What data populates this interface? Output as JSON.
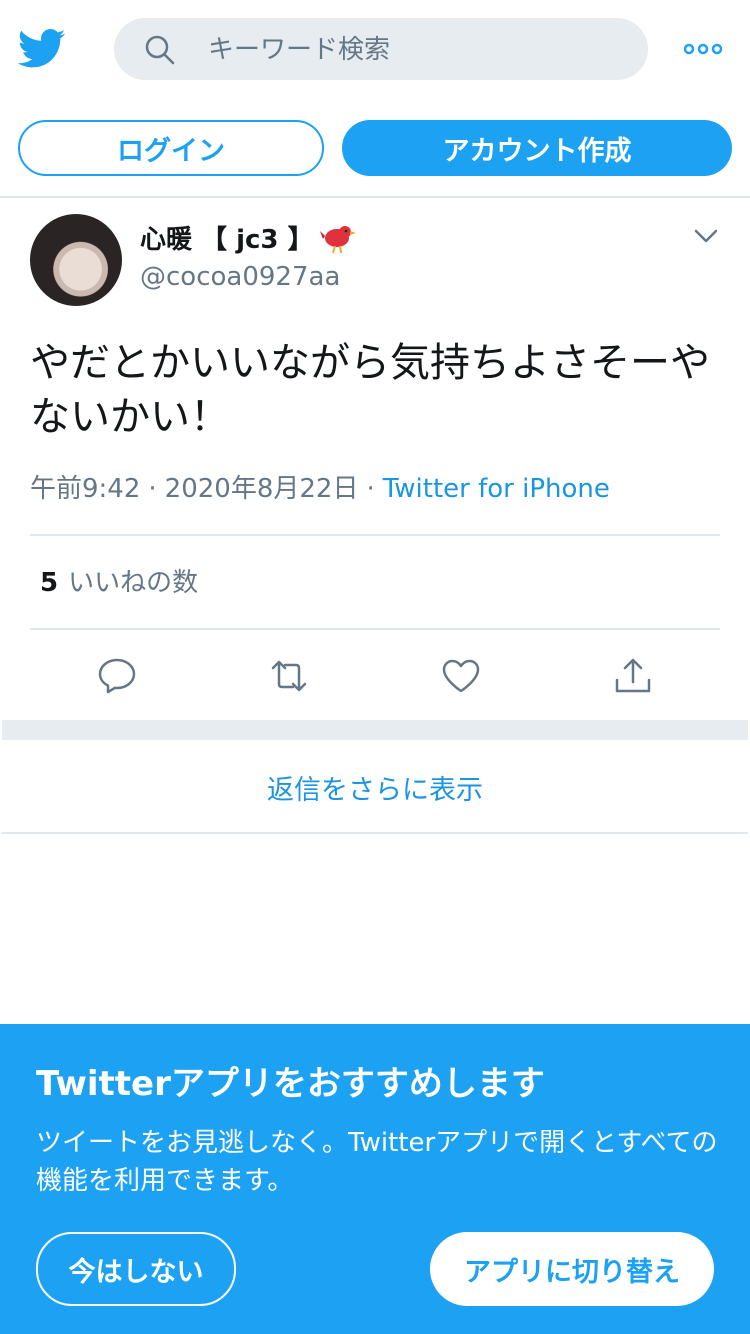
{
  "header": {
    "logo_icon": "twitter-bird-icon",
    "search": {
      "placeholder": "キーワード検索",
      "icon": "search-icon"
    },
    "more_icon": "more-dots-icon",
    "login_label": "ログイン",
    "signup_label": "アカウント作成"
  },
  "tweet": {
    "display_name": "心暖 【 jc3 】",
    "name_emoji": "bird-emoji",
    "handle": "@cocoa0927aa",
    "text": "やだとかいいながら気持ちよさそーやないかい！",
    "time": "午前9:42",
    "date": "2020年8月22日",
    "source": "Twitter for iPhone",
    "separator": "·",
    "likes_count": "5",
    "likes_label": "いいねの数",
    "actions": [
      "reply-icon",
      "retweet-icon",
      "like-icon",
      "share-icon"
    ]
  },
  "more_replies_label": "返信をさらに表示",
  "promo": {
    "title": "Twitterアプリをおすすめします",
    "text": "ツイートをお見逃しなく。Twitterアプリで開くとすべての機能を利用できます。",
    "not_now_label": "今はしない",
    "switch_label": "アプリに切り替え"
  },
  "colors": {
    "brand": "#1da1f2",
    "link": "#1b95e0",
    "secondary_text": "#657786",
    "band": "#e6ecf0"
  }
}
